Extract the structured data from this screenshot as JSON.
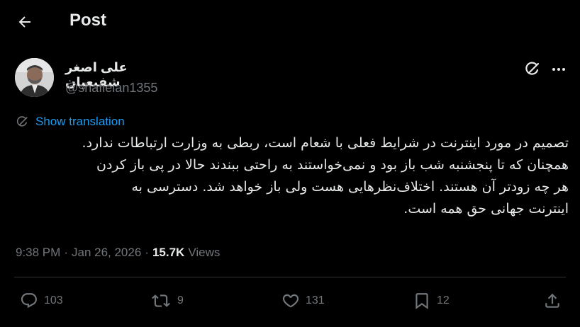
{
  "header": {
    "title": "Post"
  },
  "author": {
    "name": "علی اصغر شفیعیان",
    "handle": "@shafieian1355"
  },
  "post": {
    "show_translation": "Show translation",
    "lines": [
      "تصمیم در مورد اینترنت در شرایط فعلی با شعام است، ربطی به وزارت ارتباطات ندارد.",
      "همچنان که تا پنجشنبه شب باز بود و نمی‌خواستند به راحتی ببندند حالا در پی باز کردن",
      "هر چه زودتر آن هستند. اختلاف‌نظرهایی هست ولی باز خواهد شد. دسترسی به",
      "اینترنت جهانی حق همه است."
    ]
  },
  "meta": {
    "time": "9:38 PM",
    "sep1": "·",
    "date": "Jan 26, 2026",
    "sep2": "·",
    "views_count": "15.7K",
    "views_label": "Views"
  },
  "actions": {
    "replies": "103",
    "reposts": "9",
    "likes": "131",
    "bookmarks": "12"
  },
  "icons": {
    "back": "arrow-left-icon",
    "grok": "grok-icon",
    "more": "more-icon",
    "translate": "translate-icon",
    "reply": "reply-icon",
    "repost": "repost-icon",
    "like": "heart-icon",
    "bookmark": "bookmark-icon",
    "share": "share-icon"
  },
  "colors": {
    "accent": "#1d9bf0",
    "muted": "#71767b",
    "text": "#e7e9ea",
    "background": "#000000"
  }
}
